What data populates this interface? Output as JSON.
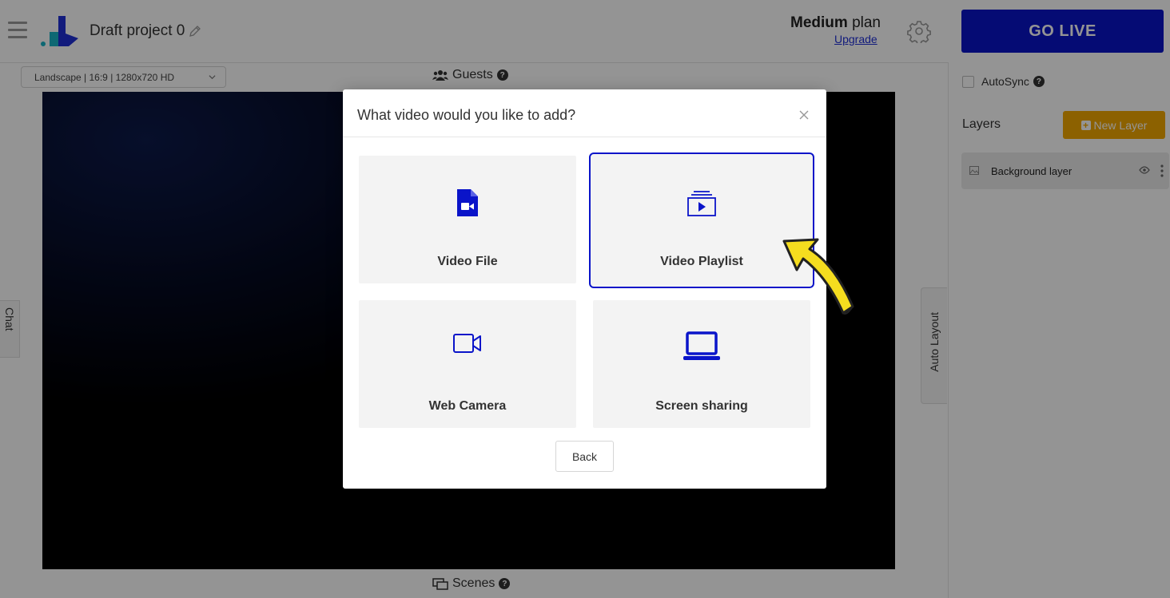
{
  "header": {
    "project_title": "Draft project 0",
    "plan_name": "Medium",
    "plan_suffix": "plan",
    "upgrade_label": "Upgrade",
    "go_live_label": "GO LIVE"
  },
  "toolbar": {
    "format_value": "Landscape | 16:9 | 1280x720 HD",
    "guests_label": "Guests",
    "scenes_label": "Scenes",
    "help_glyph": "?"
  },
  "side_tabs": {
    "chat_label": "Chat",
    "auto_layout_label": "Auto Layout"
  },
  "right_panel": {
    "autosync_label": "AutoSync",
    "layers_title": "Layers",
    "new_layer_label": "New Layer",
    "new_layer_glyph": "+",
    "layers": [
      {
        "name": "Background layer"
      }
    ]
  },
  "modal": {
    "title": "What video would you like to add?",
    "close_glyph": "×",
    "options": [
      {
        "label": "Video File",
        "icon": "video-file-icon"
      },
      {
        "label": "Video Playlist",
        "icon": "video-playlist-icon",
        "selected": true
      },
      {
        "label": "Web Camera",
        "icon": "web-camera-icon"
      },
      {
        "label": "Screen sharing",
        "icon": "laptop-icon"
      }
    ],
    "back_label": "Back"
  },
  "colors": {
    "accent": "#0a14c9",
    "new_layer": "#f2a800",
    "annotation_arrow": "#f5dd1f"
  }
}
